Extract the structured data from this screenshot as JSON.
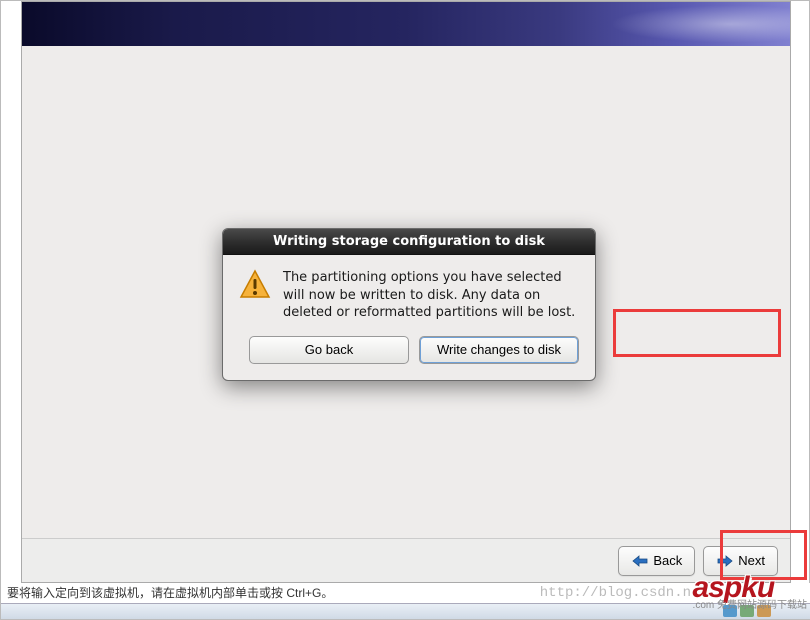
{
  "dialog": {
    "title": "Writing storage configuration to disk",
    "message": "The partitioning options you have selected will now be written to disk.  Any data on deleted or reformatted partitions will be lost.",
    "go_back_label": "Go back",
    "write_label": "Write changes to disk"
  },
  "nav": {
    "back_label": "Back",
    "next_label": "Next"
  },
  "status": {
    "hint": "要将输入定向到该虚拟机，请在虚拟机内部单击或按 Ctrl+G。",
    "watermark_url": "http://blog.csdn.n",
    "brand": "aspku",
    "brand_sub": ".com\n免费网站源码下载站"
  }
}
